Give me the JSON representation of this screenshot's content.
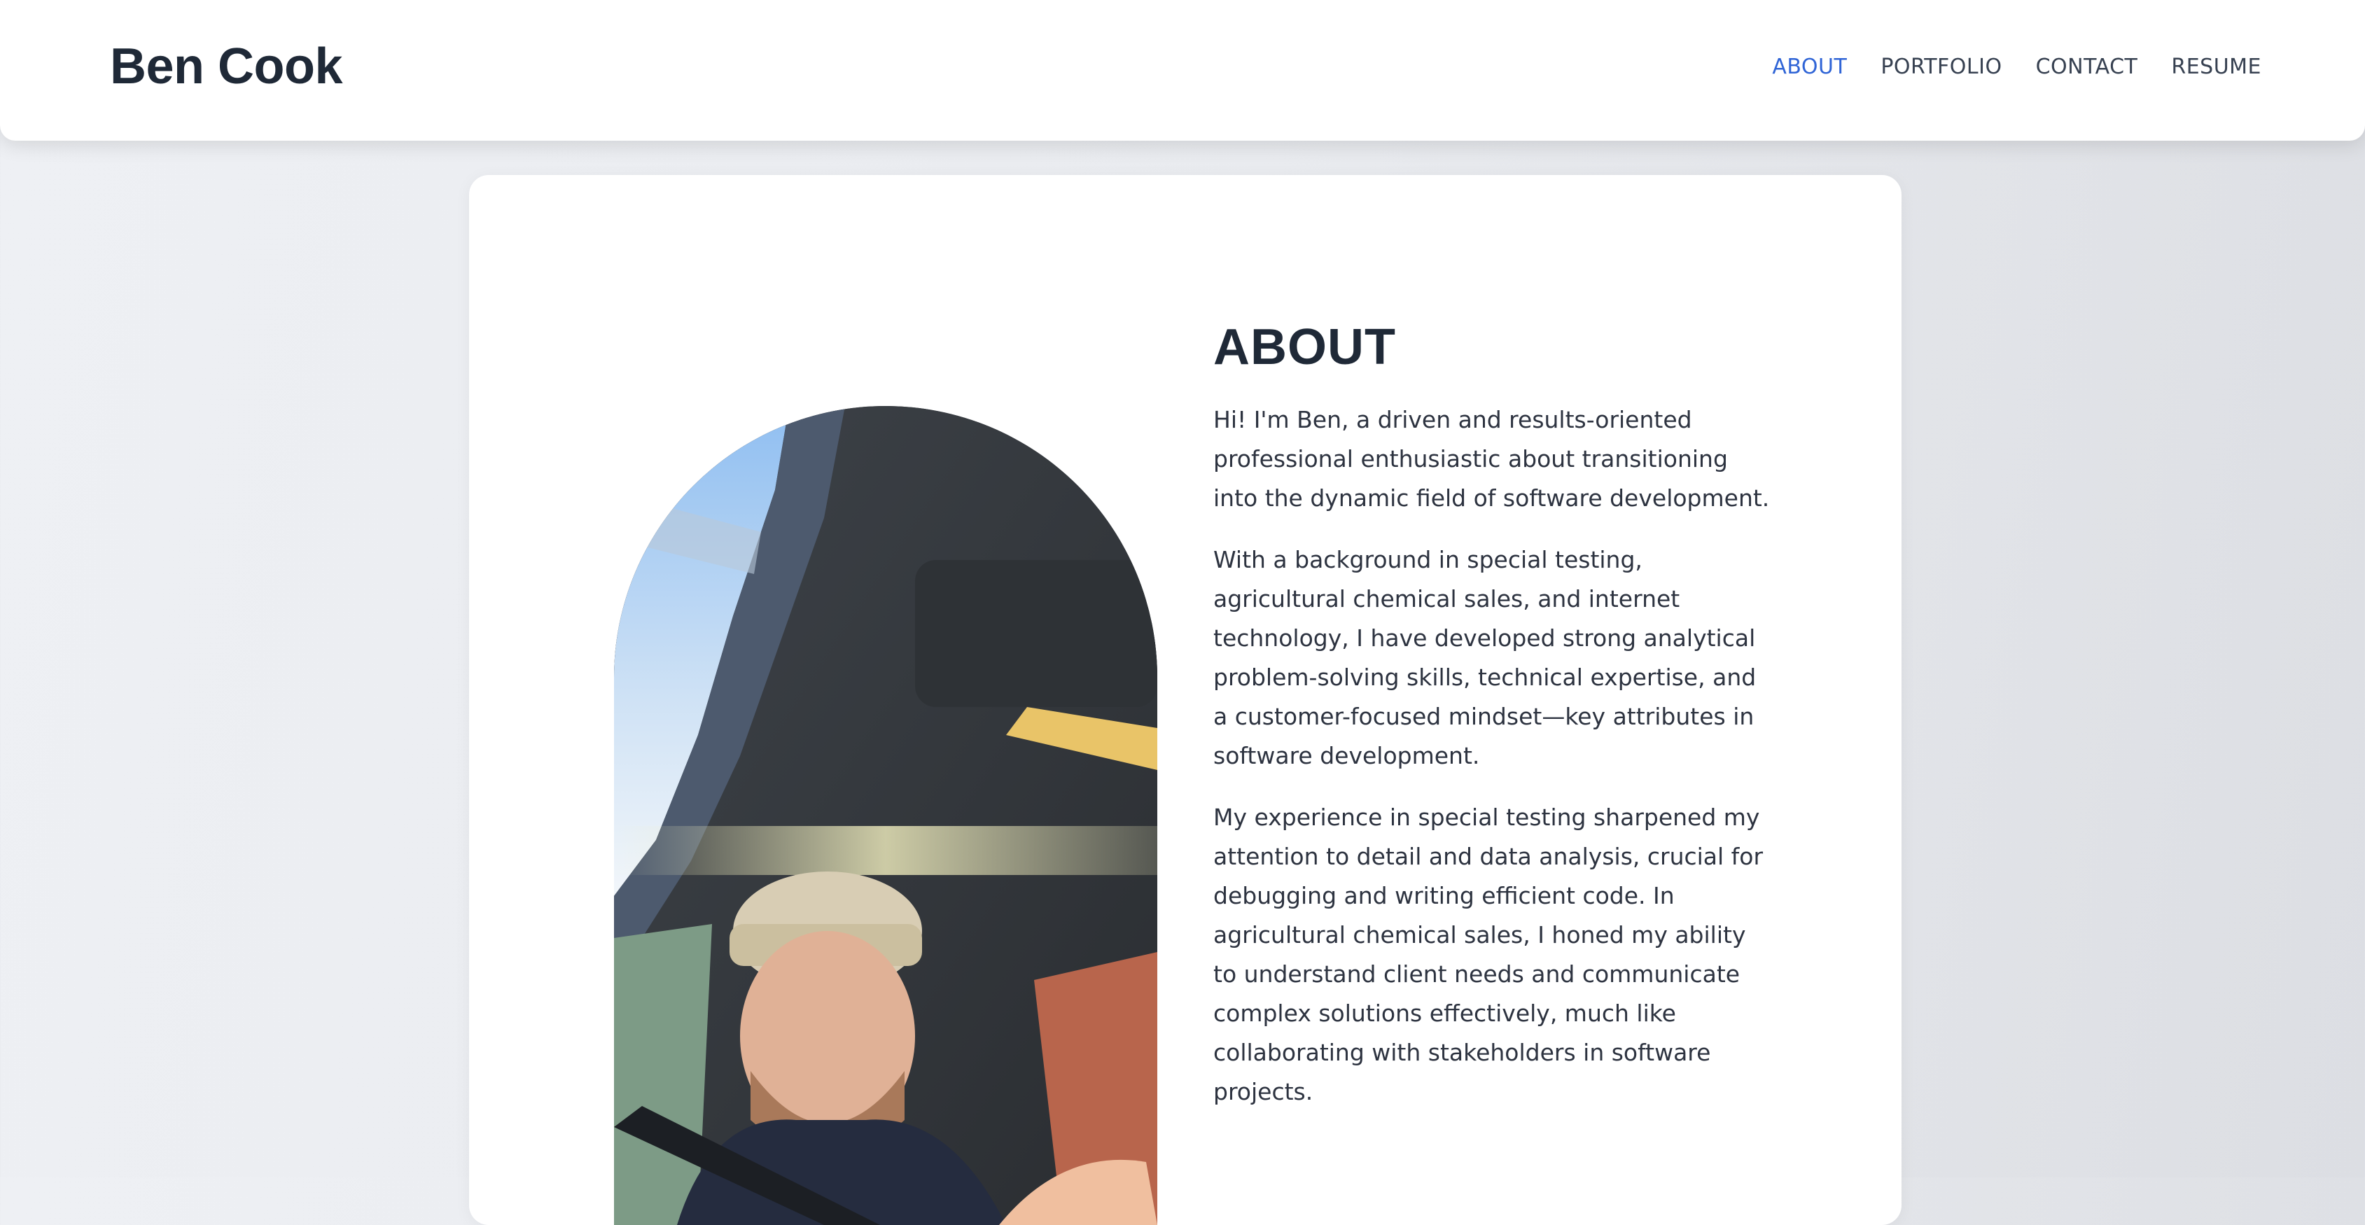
{
  "header": {
    "brand": "Ben Cook",
    "nav": [
      {
        "label": "ABOUT",
        "active": true
      },
      {
        "label": "PORTFOLIO",
        "active": false
      },
      {
        "label": "CONTACT",
        "active": false
      },
      {
        "label": "RESUME",
        "active": false
      }
    ]
  },
  "about": {
    "heading": "ABOUT",
    "paragraphs": [
      "Hi! I'm Ben, a driven and results-oriented professional enthusiastic about transitioning into the dynamic field of software development.",
      "With a background in special testing, agricultural chemical sales, and internet technology, I have developed strong analytical problem-solving skills, technical expertise, and a customer-focused mindset—key attributes in software development.",
      "My experience in special testing sharpened my attention to detail and data analysis, crucial for debugging and writing efficient code. In agricultural chemical sales, I honed my ability to understand client needs and communicate complex solutions effectively, much like collaborating with stakeholders in software projects."
    ]
  },
  "colors": {
    "accent": "#2f64d6",
    "text": "#1f2937",
    "card": "#ffffff"
  }
}
